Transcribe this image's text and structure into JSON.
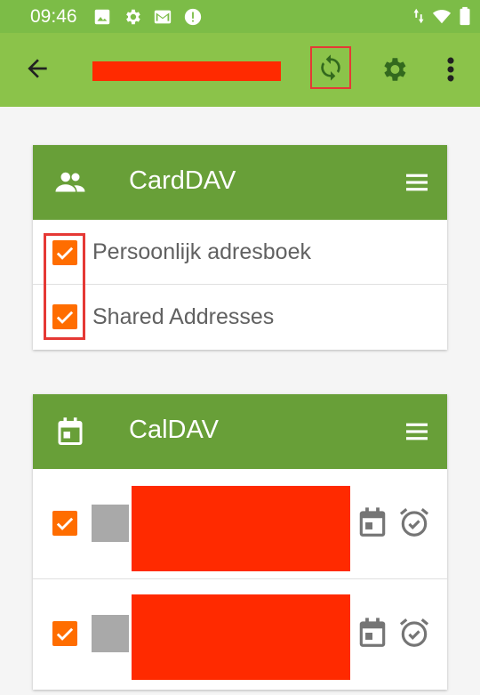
{
  "status_bar": {
    "time": "09:46",
    "icons": [
      "image-icon",
      "gear-icon",
      "gmail-icon",
      "alert-icon",
      "data-arrows-icon",
      "wifi-icon",
      "battery-icon"
    ]
  },
  "toolbar": {
    "back_icon": "arrow-back-icon",
    "account_name": "",
    "sync_icon": "sync-icon",
    "settings_icon": "gear-icon",
    "more_icon": "more-vert-icon"
  },
  "carddav": {
    "title": "CardDAV",
    "icon": "people-icon",
    "menu_icon": "menu-icon",
    "items": [
      {
        "label": "Persoonlijk adresboek",
        "checked": true
      },
      {
        "label": "Shared Addresses",
        "checked": true
      }
    ]
  },
  "caldav": {
    "title": "CalDAV",
    "icon": "calendar-icon",
    "menu_icon": "menu-icon",
    "items": [
      {
        "checked": true,
        "color": "#a9a9a9",
        "icons": [
          "calendar-event-icon",
          "alarm-check-icon"
        ]
      },
      {
        "checked": true,
        "color": "#a9a9a9",
        "icons": [
          "calendar-event-icon",
          "alarm-check-icon"
        ]
      }
    ]
  },
  "colors": {
    "status_bar": "#7cbc47",
    "toolbar": "#8bc34a",
    "card_header": "#689f38",
    "checkbox": "#ff6d00",
    "redaction": "#ff2a00",
    "highlight": "#e53935"
  }
}
